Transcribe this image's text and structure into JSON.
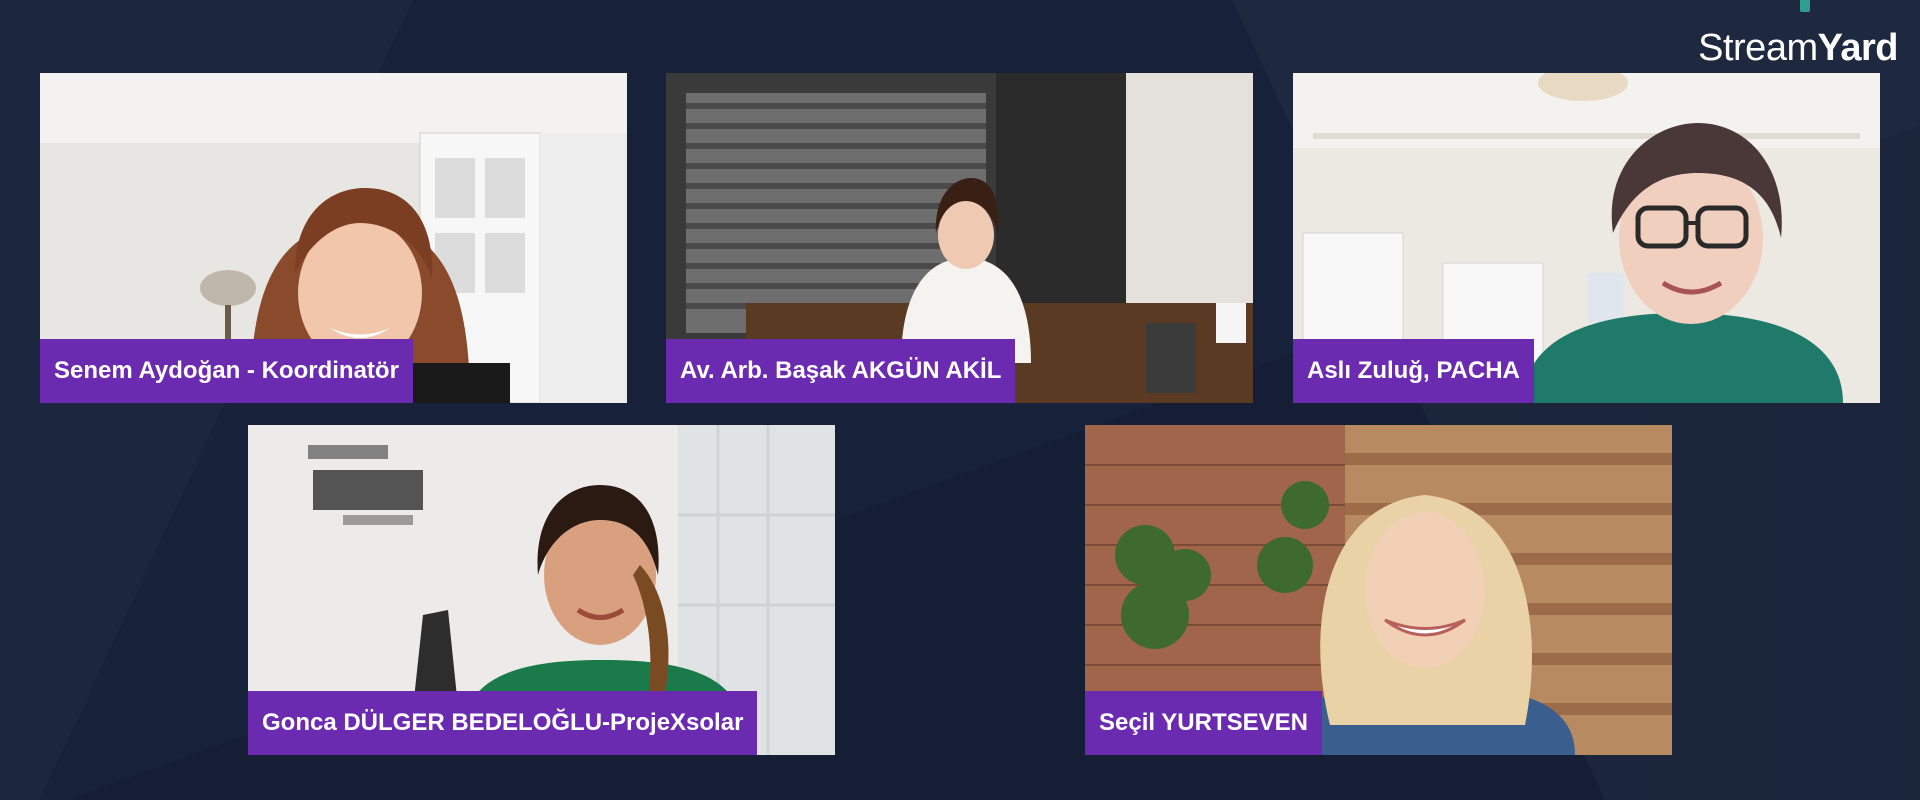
{
  "app": {
    "brand_regular": "Stream",
    "brand_bold": "Yard",
    "logo_icon": "streamyard-logo-icon",
    "accent": "#6b2bb0",
    "background": "#172139"
  },
  "participants": [
    {
      "name": "Senem Aydoğan - Koordinatör"
    },
    {
      "name": "Av. Arb. Başak AKGÜN AKİL"
    },
    {
      "name": "Aslı Zuluğ, PACHA"
    },
    {
      "name": "Gonca DÜLGER BEDELOĞLU-ProjeXsolar"
    },
    {
      "name": "Seçil YURTSEVEN"
    }
  ]
}
